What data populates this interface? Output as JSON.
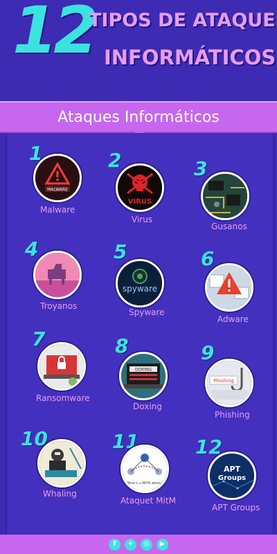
{
  "header": {
    "number": "12",
    "title_line1": "TIPOS DE ATAQUES",
    "title_line2": "INFORMÁTICOS"
  },
  "banner": {
    "text": "Ataques Informáticos"
  },
  "items": [
    {
      "num": "1",
      "label": "Malware",
      "icon": "malware-icon"
    },
    {
      "num": "2",
      "label": "Virus",
      "icon": "virus-skull-icon"
    },
    {
      "num": "3",
      "label": "Gusanos",
      "icon": "circuit-board-icon"
    },
    {
      "num": "4",
      "label": "Troyanos",
      "icon": "trojan-horse-icon"
    },
    {
      "num": "5",
      "label": "Spyware",
      "icon": "spyware-eye-icon"
    },
    {
      "num": "6",
      "label": "Adware",
      "icon": "adware-warning-icon"
    },
    {
      "num": "7",
      "label": "Ransomware",
      "icon": "ransomware-lock-icon"
    },
    {
      "num": "8",
      "label": "Doxing",
      "icon": "doxing-laptop-icon"
    },
    {
      "num": "9",
      "label": "Phishing",
      "icon": "phishing-hook-icon"
    },
    {
      "num": "10",
      "label": "Whaling",
      "icon": "whaling-hacker-icon"
    },
    {
      "num": "11",
      "label": "Ataquet MitM",
      "icon": "mitm-diagram-icon"
    },
    {
      "num": "12",
      "label": "APT Groups",
      "icon": "apt-groups-icon"
    }
  ],
  "icon_texts": {
    "malware": "MALWARE",
    "virus": "VIRUS",
    "spyware": "spyware",
    "doxing": "DOXING",
    "phishing": "Phishing",
    "mitm": "What is a MITM attack?",
    "apt": "APT\nGroups"
  },
  "footer": {
    "icons": [
      "facebook-icon",
      "twitter-icon",
      "instagram-icon",
      "youtube-icon"
    ]
  },
  "colors": {
    "background": "#3d2bb3",
    "accent_cyan": "#3be3e0",
    "accent_pink": "#e79cf2",
    "banner": "#c767f0"
  }
}
